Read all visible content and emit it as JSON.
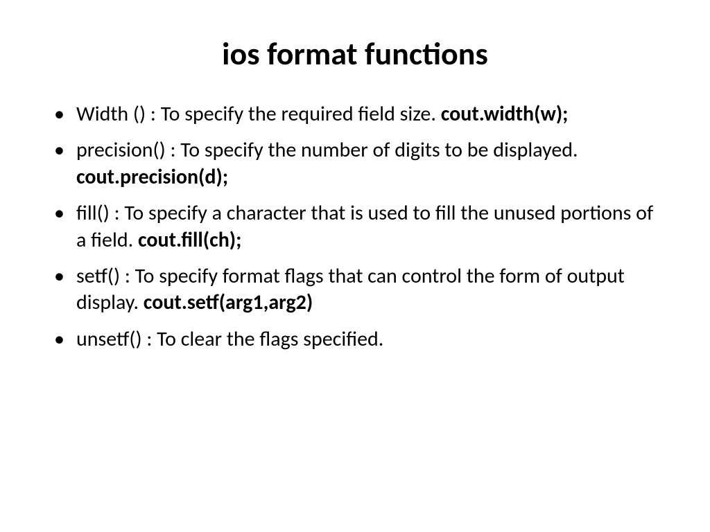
{
  "title": "ios format functions",
  "bullets": [
    {
      "desc": "Width () : To specify the required field size. ",
      "code": "cout.width(w);"
    },
    {
      "desc": "precision() : To specify the number of digits to be displayed. ",
      "code": "cout.precision(d);"
    },
    {
      "desc": "fill() : To specify a character that is used to fill the unused portions of a field. ",
      "code": "cout.fill(ch);"
    },
    {
      "desc": "setf() : To specify format flags that can control the form of output display. ",
      "code": "cout.setf(arg1,arg2)"
    },
    {
      "desc": "unsetf() : To clear the flags specified.",
      "code": ""
    }
  ]
}
